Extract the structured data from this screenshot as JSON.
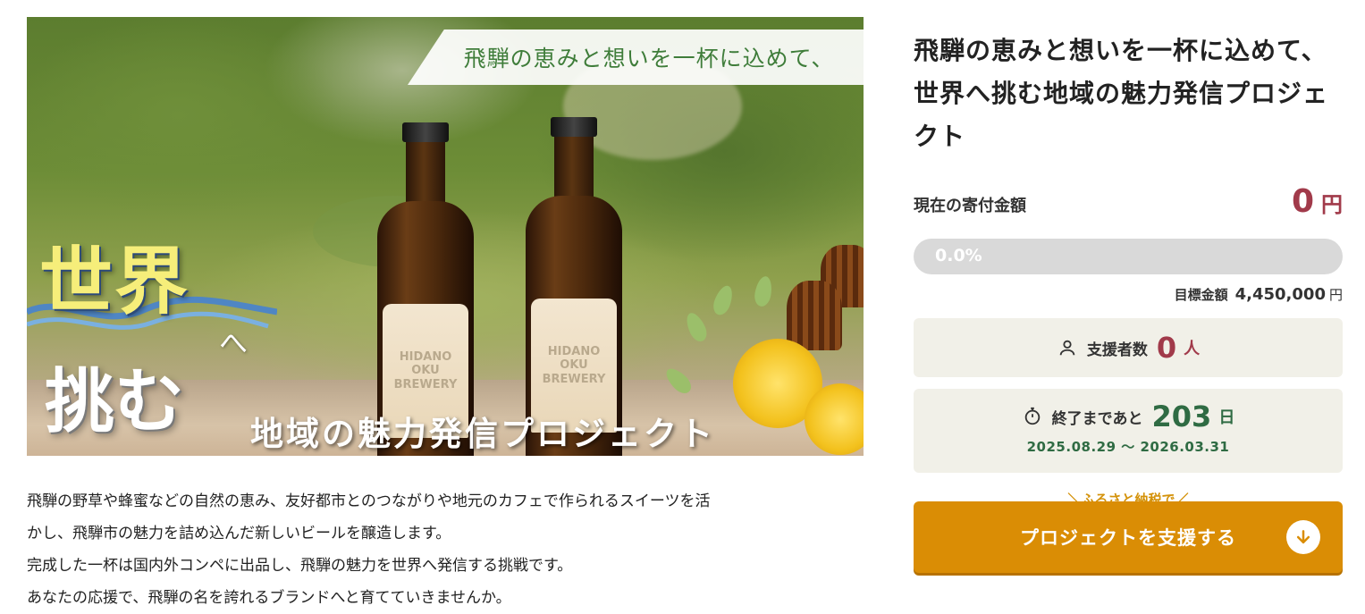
{
  "hero": {
    "tagline": "飛騨の恵みと想いを一杯に込めて、",
    "headline_1": "世界",
    "headline_he": "へ",
    "headline_2": "挑む",
    "sub_headline": "地域の魅力発信プロジェクト",
    "bottle_label_1": "HIDANO",
    "bottle_label_2": "OKU",
    "bottle_label_3": "BREWERY"
  },
  "description": {
    "lines": [
      "飛騨の野草や蜂蜜などの自然の恵み、友好都市とのつながりや地元のカフェで作られるスイーツを活",
      "かし、飛騨市の魅力を詰め込んだ新しいビールを醸造します。",
      "完成した一杯は国内外コンペに出品し、飛騨の魅力を世界へ発信する挑戦です。",
      "あなたの応援で、飛騨の名を誇れるブランドへと育てていきませんか。"
    ]
  },
  "project": {
    "title": "飛騨の恵みと想いを一杯に込めて、世界へ挑む地域の魅力発信プロジェクト",
    "amount_label": "現在の寄付金額",
    "amount_value": "0",
    "amount_unit": "円",
    "progress_text": "0.0%",
    "progress_fraction": 0.0,
    "goal_label": "目標金額",
    "goal_value": "4,450,000",
    "goal_unit": "円",
    "supporters_label": "支援者数",
    "supporters_value": "0",
    "supporters_unit": "人",
    "remaining_label": "終了まであと",
    "remaining_value": "203",
    "remaining_unit": "日",
    "date_range": "2025.08.29 ～ 2026.03.31",
    "furusato_label": "＼ふるさと納税で／",
    "cta_label": "プロジェクトを支援する"
  },
  "icons": {
    "supporters": "person-icon",
    "remaining": "stopwatch-icon",
    "cta": "arrow-down-circle-icon"
  },
  "colors": {
    "amount": "#a13a4a",
    "remaining": "#2f6b43",
    "cta": "#da8d05",
    "progress_track": "#d9d9d9"
  }
}
